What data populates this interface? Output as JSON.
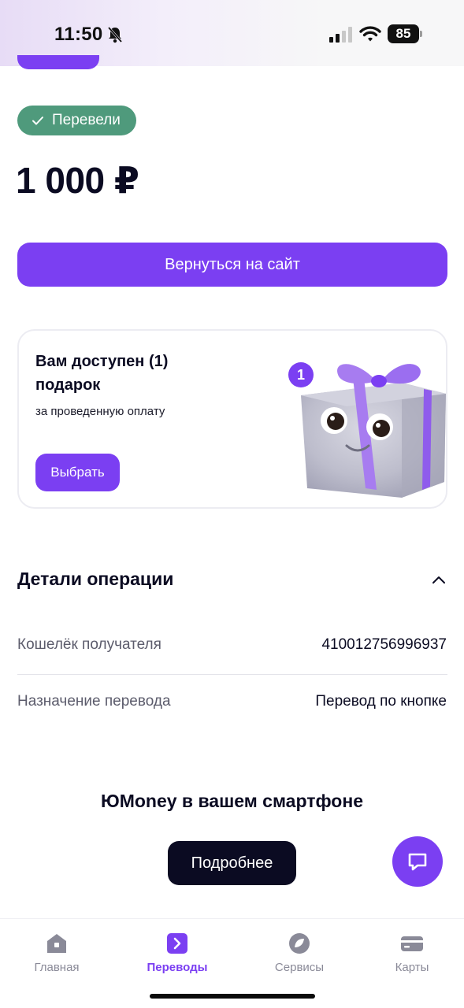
{
  "status_bar": {
    "time": "11:50",
    "battery": "85"
  },
  "status_chip": {
    "label": "Перевели",
    "color": "#4f9a7c"
  },
  "amount": "1 000 ₽",
  "primary_button": {
    "label": "Вернуться на сайт"
  },
  "gift": {
    "title": "Вам доступен (1) подарок",
    "subtitle": "за проведенную оплату",
    "button": "Выбрать",
    "badge": "1"
  },
  "details": {
    "title": "Детали операции",
    "rows": [
      {
        "label": "Кошелёк получателя",
        "value": "410012756996937"
      },
      {
        "label": "Назначение перевода",
        "value": "Перевод по кнопке"
      }
    ]
  },
  "promo": {
    "title": "ЮMoney в вашем смартфоне",
    "button": "Подробнее"
  },
  "tabs": [
    {
      "label": "Главная",
      "icon": "home-icon",
      "active": false
    },
    {
      "label": "Переводы",
      "icon": "transfers-icon",
      "active": true
    },
    {
      "label": "Сервисы",
      "icon": "services-icon",
      "active": false
    },
    {
      "label": "Карты",
      "icon": "card-icon",
      "active": false
    }
  ],
  "colors": {
    "accent": "#7b3ff2",
    "success": "#4f9a7c",
    "dark": "#0b0b22"
  }
}
